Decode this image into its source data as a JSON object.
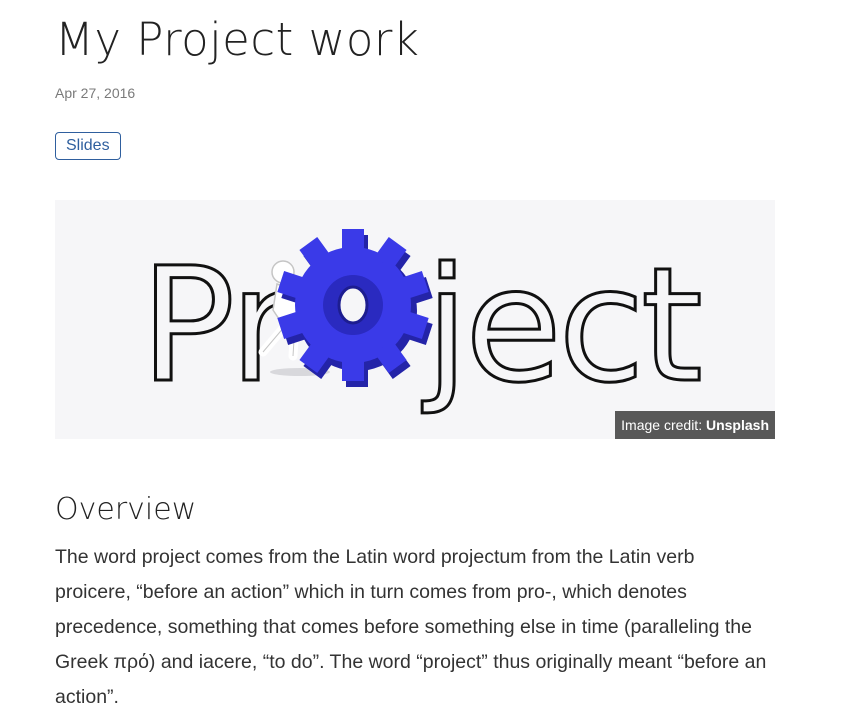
{
  "article": {
    "title": "My Project work",
    "date": "Apr 27, 2016",
    "tag": "Slides",
    "image": {
      "word": "Project",
      "credit_prefix": "Image credit: ",
      "credit_source": "Unsplash",
      "gear_color": "#3a3ae8"
    },
    "section_heading": "Overview",
    "body": "The word project comes from the Latin word projectum from the Latin verb proicere, “before an action” which in turn comes from pro-, which denotes precedence, something that comes before something else in time (paralleling the Greek πρό) and iacere, “to do”. The word “project” thus originally meant “before an action”."
  },
  "colors": {
    "link": "#2f5f9e",
    "text": "#333333",
    "muted": "#7a7a7a"
  }
}
